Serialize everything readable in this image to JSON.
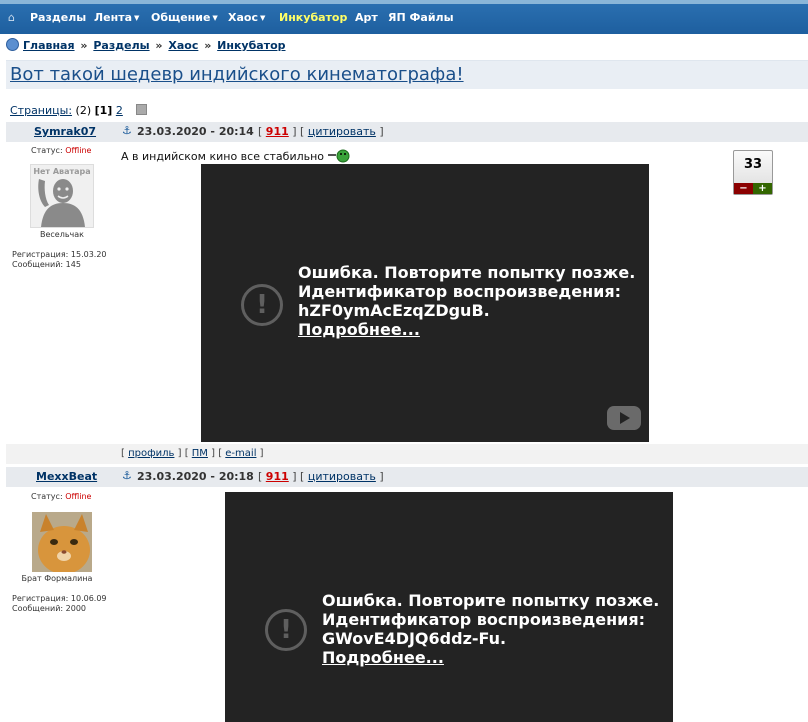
{
  "nav": {
    "home_icon": "home-icon",
    "items": [
      "Разделы",
      "Лента",
      "Общение",
      "Хаос",
      "Инкубатор",
      "Арт",
      "ЯП Файлы"
    ],
    "dropdown_mark": "▼"
  },
  "breadcrumb": {
    "items": [
      "Главная",
      "Разделы",
      "Хаос",
      "Инкубатор"
    ],
    "separator": "»"
  },
  "thread": {
    "title": "Вот такой шедевр индийского кинематографа!"
  },
  "pages": {
    "label": "Страницы:",
    "total": "(2)",
    "current": "[1]",
    "next": "2"
  },
  "posts": [
    {
      "author": "Symrak07",
      "date": "23.03.2020 - 20:14",
      "post_no": "911",
      "quote": "цитировать",
      "status_label": "Статус:",
      "status": "Offline",
      "avatar_text": "Нет Аватара",
      "rank": "Весельчак",
      "reg": "Регистрация: 15.03.20",
      "msgs": "Сообщений: 145",
      "text": "А в индийском кино все стабильно",
      "karma": "33",
      "video": {
        "line1": "Ошибка. Повторите попытку позже.",
        "line2": "Идентификатор воспроизведения:",
        "line3": "hZF0ymAcEzqZDguB.",
        "more": "Подробнее..."
      }
    },
    {
      "author": "MexxBeat",
      "date": "23.03.2020 - 20:18",
      "post_no": "911",
      "quote": "цитировать",
      "status_label": "Статус:",
      "status": "Offline",
      "rank": "Брат Формалина",
      "reg": "Регистрация: 10.06.09",
      "msgs": "Сообщений: 2000",
      "video": {
        "line1": "Ошибка. Повторите попытку позже.",
        "line2": "Идентификатор воспроизведения:",
        "line3": "GWovE4DJQ6ddz-Fu.",
        "more": "Подробнее..."
      }
    }
  ],
  "post_footer": {
    "profile": "профиль",
    "pm": "ПМ",
    "email": "e-mail"
  }
}
